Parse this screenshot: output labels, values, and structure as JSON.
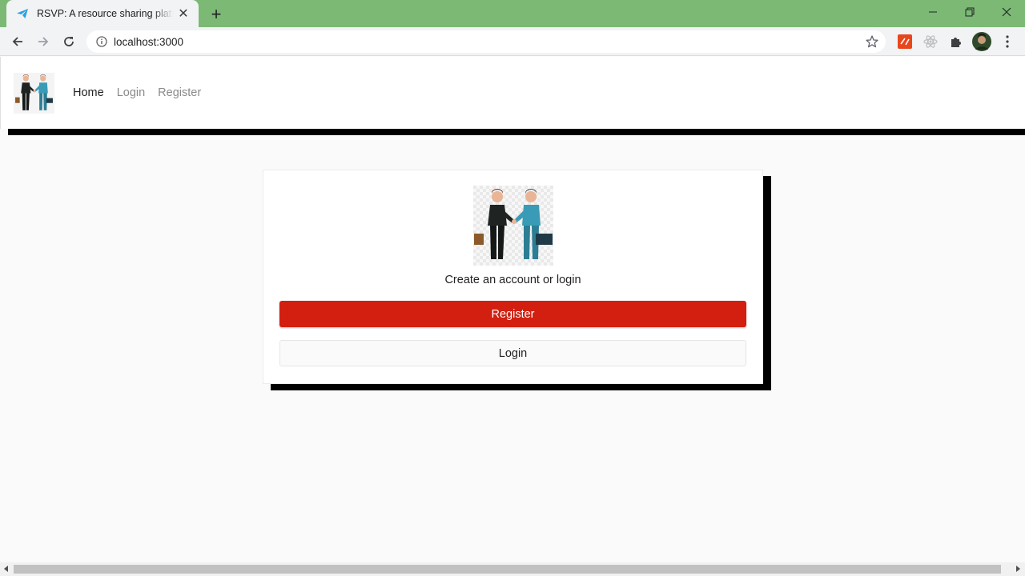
{
  "browser": {
    "tab_title": "RSVP: A resource sharing platform",
    "url": "localhost:3000",
    "tab_favicon": "paper-plane-icon"
  },
  "nav": {
    "links": [
      "Home",
      "Login",
      "Register"
    ],
    "active": "Home"
  },
  "card": {
    "subtitle": "Create an account or login",
    "register_label": "Register",
    "login_label": "Login"
  },
  "colors": {
    "tabbar": "#7bb974",
    "register_button": "#d21f10",
    "shadow": "#000000"
  }
}
